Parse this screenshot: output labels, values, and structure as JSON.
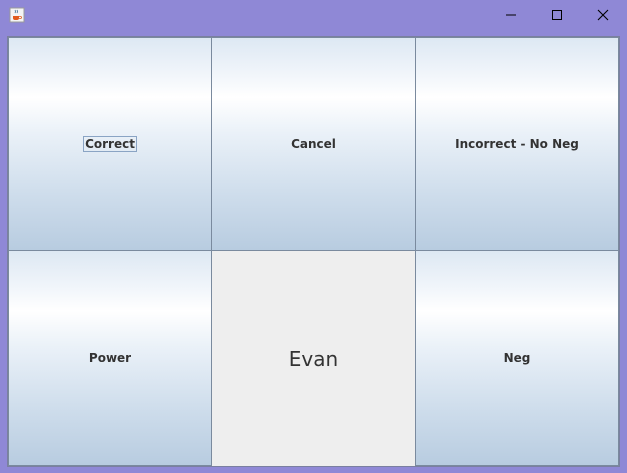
{
  "window": {
    "icons": {
      "app": "java-cup-icon",
      "minimize": "minimize-icon",
      "maximize": "maximize-icon",
      "close": "close-icon"
    }
  },
  "buttons": {
    "correct": "Correct",
    "cancel": "Cancel",
    "incorrect_no_neg": "Incorrect - No Neg",
    "power": "Power",
    "neg": "Neg"
  },
  "player_name": "Evan",
  "colors": {
    "titlebar": "#8f88d6",
    "panel_bg": "#eeeeee",
    "button_gradient_top": "#ffffff",
    "button_gradient_bottom": "#b8cce0",
    "text": "#333333"
  }
}
